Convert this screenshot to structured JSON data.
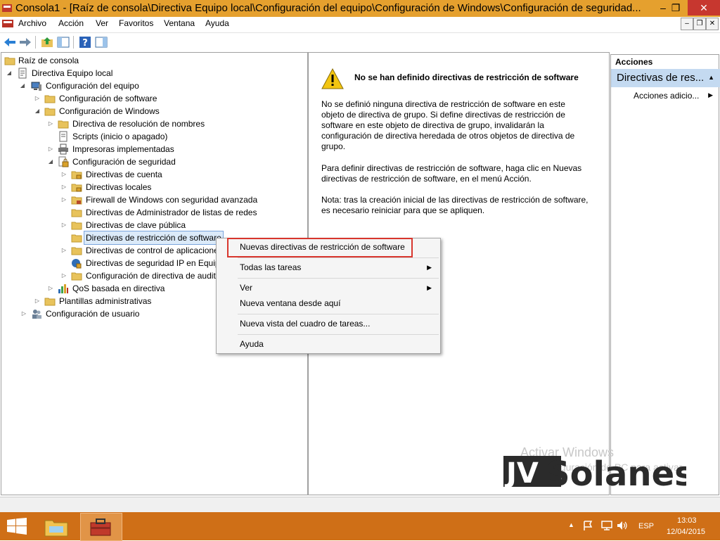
{
  "window": {
    "title": "Consola1 - [Raíz de consola\\Directiva Equipo local\\Configuración del equipo\\Configuración de Windows\\Configuración de seguridad...",
    "minimize": "–",
    "restore": "❐",
    "close": "✕"
  },
  "menubar": {
    "items": [
      "Archivo",
      "Acción",
      "Ver",
      "Favoritos",
      "Ventana",
      "Ayuda"
    ]
  },
  "tree": {
    "items": [
      {
        "label": "Raíz de consola"
      },
      {
        "label": "Directiva Equipo local"
      },
      {
        "label": "Configuración del equipo"
      },
      {
        "label": "Configuración de software"
      },
      {
        "label": "Configuración de Windows"
      },
      {
        "label": "Directiva de resolución de nombres"
      },
      {
        "label": "Scripts (inicio o apagado)"
      },
      {
        "label": "Impresoras implementadas"
      },
      {
        "label": "Configuración de seguridad"
      },
      {
        "label": "Directivas de cuenta"
      },
      {
        "label": "Directivas locales"
      },
      {
        "label": "Firewall de Windows con seguridad avanzada"
      },
      {
        "label": "Directivas de Administrador de listas de redes"
      },
      {
        "label": "Directivas de clave pública"
      },
      {
        "label": "Directivas de restricción de software"
      },
      {
        "label": "Directivas de control de aplicaciones"
      },
      {
        "label": "Directivas de seguridad IP en Equipo local"
      },
      {
        "label": "Configuración de directiva de auditoría avanzada"
      },
      {
        "label": "QoS basada en directiva"
      },
      {
        "label": "Plantillas administrativas"
      },
      {
        "label": "Configuración de usuario"
      }
    ]
  },
  "content": {
    "heading": "No se han definido directivas de restricción de software",
    "para1": "No se definió ninguna directiva de restricción de software en este objeto de directiva de grupo. Si define directivas de restricción de software en este objeto de directiva de grupo, invalidarán la configuración de directiva heredada de otros objetos de directiva de grupo.",
    "para2": "Para definir directivas de restricción de software, haga clic en Nuevas directivas de restricción de software, en el menú Acción.",
    "para3": "Nota: tras la creación inicial de las directivas de restricción de software, es necesario reiniciar para que se apliquen."
  },
  "actions": {
    "header": "Acciones",
    "section": "Directivas de res...",
    "item": "Acciones adicio..."
  },
  "context_menu": {
    "items": [
      "Nuevas directivas de restricción de software",
      "Todas las tareas",
      "Ver",
      "Nueva ventana desde aquí",
      "Nueva vista del cuadro de tareas...",
      "Ayuda"
    ]
  },
  "watermark": {
    "line1": "Activar Windows",
    "line2": "Ir a Configuración de PC para activar",
    "logo": "JVSolanes"
  },
  "taskbar": {
    "lang": "ESP",
    "time": "13:03",
    "date": "12/04/2015"
  },
  "colors": {
    "titlebar": "#e5a02e",
    "taskbar": "#cf6f17",
    "close": "#c7372f",
    "selection": "#dbeaf9",
    "highlight_box": "#d8362d"
  }
}
